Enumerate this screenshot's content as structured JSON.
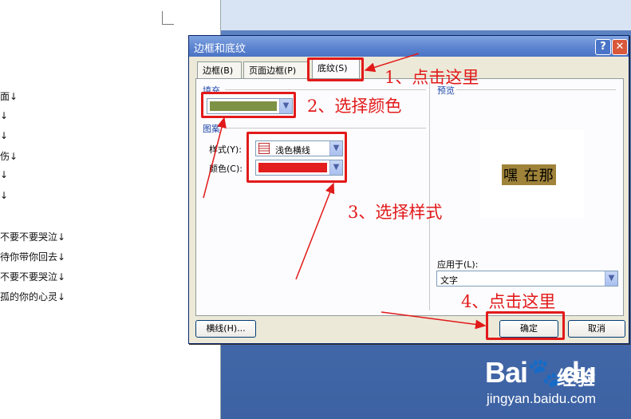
{
  "document": {
    "lines": [
      "面↓",
      "↓",
      "↓",
      "伤↓",
      "↓",
      "↓",
      "不要不要哭泣↓",
      "待你带你回去↓",
      "不要不要哭泣↓",
      "孤的你的心灵↓"
    ]
  },
  "dialog": {
    "title": "边框和底纹",
    "help_glyph": "?",
    "close_glyph": "✕",
    "tabs": [
      {
        "label": "边框(B)"
      },
      {
        "label": "页面边框(P)"
      },
      {
        "label": "底纹(S)"
      }
    ],
    "fill": {
      "label": "填充",
      "color": "#7e9246"
    },
    "pattern": {
      "label": "图案",
      "style_label": "样式(Y):",
      "style_value": "浅色横线",
      "color_label": "颜色(C):",
      "color_value": "#e21e1e"
    },
    "preview": {
      "label": "预览",
      "text": "嘿 在那"
    },
    "apply_to": {
      "label": "应用于(L):",
      "value": "文字"
    },
    "buttons": {
      "horizontal_line": "横线(H)...",
      "ok": "确定",
      "cancel": "取消"
    }
  },
  "annotations": {
    "step1": "1、点击这里",
    "step2": "2、选择颜色",
    "step3": "3、选择样式",
    "step4": "4、点击这里"
  },
  "watermark": {
    "logo": "Bai",
    "logo_paw": "🐾",
    "logo_du": "du",
    "cn": "经验",
    "url": "jingyan.baidu.com"
  },
  "colors": {
    "annotation_red": "#e21a1a",
    "titlebar_blue": "#5a82cf"
  }
}
